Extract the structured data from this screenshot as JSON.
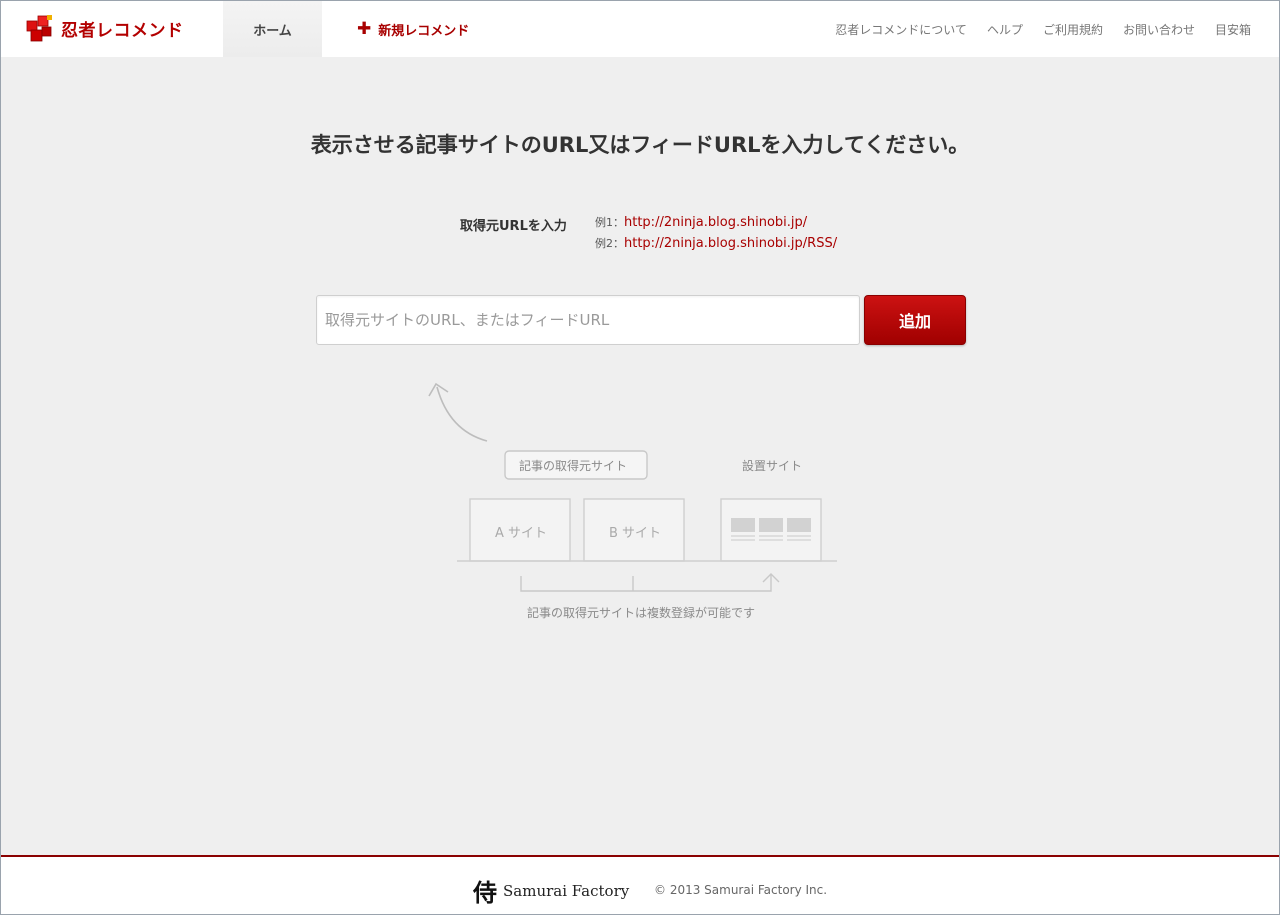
{
  "header": {
    "logo_text": "忍者レコメンド",
    "nav": {
      "home": "ホーム",
      "new_recommend": "新規レコメンド"
    },
    "links": [
      "忍者レコメンドについて",
      "ヘルプ",
      "ご利用規約",
      "お問い合わせ",
      "目安箱"
    ]
  },
  "main": {
    "title": "表示させる記事サイトのURL又はフィードURLを入力してください。",
    "source_label": "取得元URLを入力",
    "examples": [
      {
        "label": "例1：",
        "url": "http://2ninja.blog.shinobi.jp/"
      },
      {
        "label": "例2：",
        "url": "http://2ninja.blog.shinobi.jp/RSS/"
      }
    ],
    "input_placeholder": "取得元サイトのURL、またはフィードURL",
    "add_button": "追加"
  },
  "illustration": {
    "source_site_label": "記事の取得元サイト",
    "placement_site_label": "設置サイト",
    "site_a": "A サイト",
    "site_b": "B サイト",
    "note": "記事の取得元サイトは複数登録が可能です"
  },
  "footer": {
    "brand_kanji": "侍",
    "brand_name": "Samurai Factory",
    "copyright": "© 2013 Samurai Factory Inc."
  },
  "colors": {
    "accent": "#a80000",
    "background": "#efefef",
    "header_bg": "#ffffff"
  }
}
